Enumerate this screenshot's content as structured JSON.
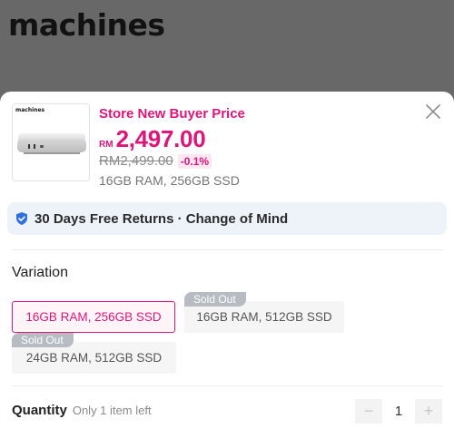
{
  "background_page": {
    "brand_text": "machines"
  },
  "product": {
    "thumbnail_brand": "machines",
    "promo_title": "Store New Buyer Price",
    "currency": "RM",
    "price": "2,497.00",
    "original_price": "RM2,499.00",
    "discount": "-0.1%",
    "selected_variant": "16GB RAM, 256GB SSD"
  },
  "returns_banner": {
    "text": "30 Days Free Returns · Change of Mind",
    "icon": "shield-check-icon"
  },
  "variation": {
    "title": "Variation",
    "sold_out_label": "Sold Out",
    "options": [
      {
        "label": "16GB RAM, 256GB SSD",
        "state": "selected"
      },
      {
        "label": "16GB RAM, 512GB SSD",
        "state": "sold_out"
      },
      {
        "label": "24GB RAM, 512GB SSD",
        "state": "sold_out"
      }
    ]
  },
  "quantity": {
    "title": "Quantity",
    "note": "Only 1 item left",
    "value": "1",
    "minus": "−",
    "plus": "+"
  },
  "colors": {
    "accent": "#e0157a",
    "returns_bg": "#eef3f9",
    "shield": "#2f6fe0"
  }
}
